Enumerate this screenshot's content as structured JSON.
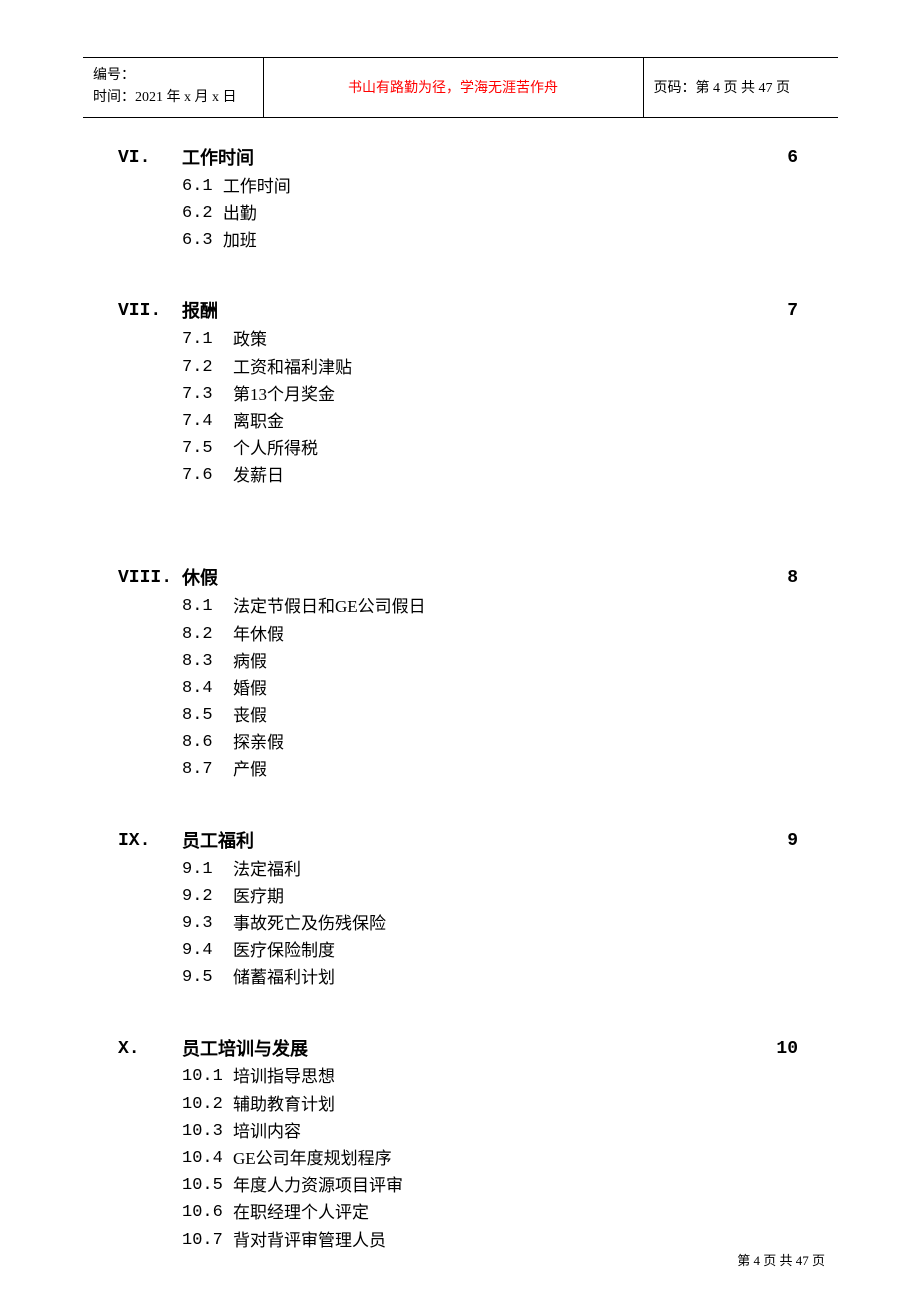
{
  "header": {
    "line1": "编号：",
    "line2": "时间：2021 年 x 月 x 日",
    "motto": "书山有路勤为径，学海无涯苦作舟",
    "pageinfo": "页码：第 4 页  共 47 页"
  },
  "sections": [
    {
      "roman": "VI.",
      "title": "工作时间",
      "page": "6",
      "items": [
        {
          "num": "6.1 ",
          "text": "工作时间"
        },
        {
          "num": "6.2 ",
          "text": "出勤"
        },
        {
          "num": "6.3 ",
          "text": "加班"
        }
      ],
      "spacer": "normal"
    },
    {
      "roman": "VII.",
      "title": "报酬",
      "page": "7",
      "items": [
        {
          "num": "7.1  ",
          "text": "政策"
        },
        {
          "num": "7.2  ",
          "text": "工资和福利津贴"
        },
        {
          "num": "7.3  ",
          "text": "第13个月奖金"
        },
        {
          "num": "7.4  ",
          "text": "离职金"
        },
        {
          "num": "7.5  ",
          "text": "个人所得税"
        },
        {
          "num": "7.6  ",
          "text": "发薪日"
        }
      ],
      "spacer": "big"
    },
    {
      "roman": "VIII.",
      "title": "休假",
      "page": "8",
      "items": [
        {
          "num": "8.1  ",
          "text": "法定节假日和GE公司假日"
        },
        {
          "num": "8.2  ",
          "text": "年休假"
        },
        {
          "num": "8.3  ",
          "text": "病假"
        },
        {
          "num": "8.4  ",
          "text": "婚假"
        },
        {
          "num": "8.5  ",
          "text": "丧假"
        },
        {
          "num": "8.6  ",
          "text": "探亲假"
        },
        {
          "num": "8.7  ",
          "text": "产假"
        }
      ],
      "spacer": "normal"
    },
    {
      "roman": "IX.",
      "title": "员工福利",
      "page": "9",
      "items": [
        {
          "num": "9.1  ",
          "text": "法定福利"
        },
        {
          "num": "9.2  ",
          "text": "医疗期"
        },
        {
          "num": "9.3  ",
          "text": "事故死亡及伤残保险"
        },
        {
          "num": "9.4  ",
          "text": "医疗保险制度"
        },
        {
          "num": "9.5  ",
          "text": "储蓄福利计划"
        }
      ],
      "spacer": "normal"
    },
    {
      "roman": "X.",
      "title": "员工培训与发展",
      "page": "10",
      "items": [
        {
          "num": "10.1 ",
          "text": "培训指导思想"
        },
        {
          "num": "10.2 ",
          "text": "辅助教育计划"
        },
        {
          "num": "10.3 ",
          "text": "培训内容"
        },
        {
          "num": "10.4 ",
          "text": "GE公司年度规划程序"
        },
        {
          "num": "10.5 ",
          "text": "年度人力资源项目评审"
        },
        {
          "num": "10.6 ",
          "text": "在职经理个人评定"
        },
        {
          "num": "10.7 ",
          "text": "背对背评审管理人员"
        }
      ],
      "spacer": "none"
    }
  ],
  "footer": "第 4 页 共 47 页"
}
